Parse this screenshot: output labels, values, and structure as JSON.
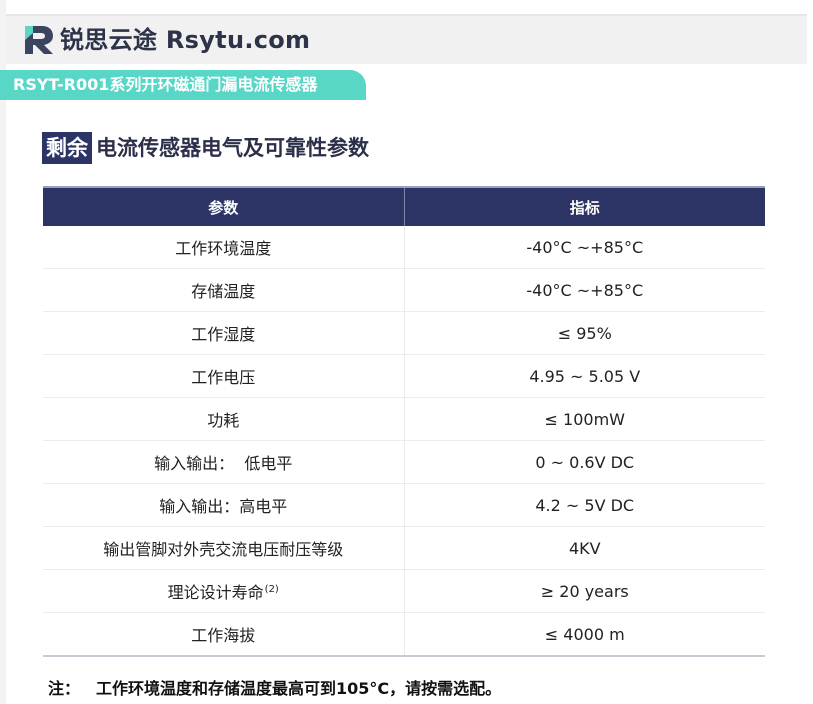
{
  "header": {
    "brand": "锐思云途 Rsytu.com",
    "logo_icon": "rs-logo-icon",
    "logo_colors": [
      "#3b4560",
      "#5ed4c4"
    ]
  },
  "series_tag": "RSYT-R001系列开环磁通门漏电流传感器",
  "section": {
    "badge": "剩余",
    "title": "电流传感器电气及可靠性参数"
  },
  "table": {
    "headers": [
      "参数",
      "指标"
    ],
    "rows": [
      {
        "param": "工作环境温度",
        "sup": "",
        "value": "-40°C ~+85°C"
      },
      {
        "param": "存储温度",
        "sup": "",
        "value": "-40°C ~+85°C"
      },
      {
        "param": "工作湿度",
        "sup": "",
        "value": "≤ 95%"
      },
      {
        "param": "工作电压",
        "sup": "",
        "value": "4.95 ~ 5.05 V"
      },
      {
        "param": "功耗",
        "sup": "",
        "value": "≤ 100mW"
      },
      {
        "param": "输入输出：  低电平",
        "sup": "",
        "value": "0 ~ 0.6V DC"
      },
      {
        "param": "输入输出：高电平",
        "sup": "",
        "value": "4.2 ~ 5V DC"
      },
      {
        "param": "输出管脚对外壳交流电压耐压等级",
        "sup": "",
        "value": "4KV"
      },
      {
        "param": "理论设计寿命",
        "sup": "(2)",
        "value": "≥ 20 years"
      },
      {
        "param": "工作海拔",
        "sup": "",
        "value": "≤ 4000 m"
      }
    ]
  },
  "note": {
    "label": "注：",
    "text": "工作环境温度和存储温度最高可到105°C，请按需选配。"
  },
  "colors": {
    "header_bg": "#f1f1f1",
    "brand_text": "#2d3348",
    "accent_teal": "#58d6c6",
    "navy": "#2b3464"
  }
}
